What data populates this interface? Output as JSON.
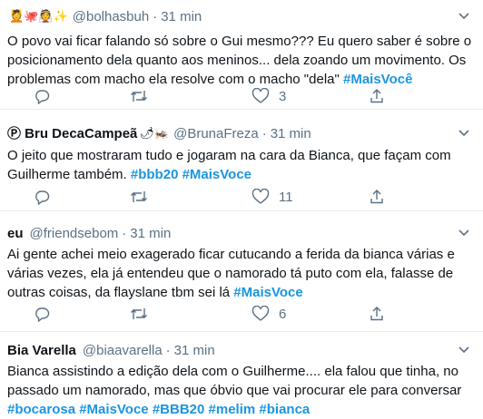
{
  "tweets": [
    {
      "name": "",
      "emojis": "💆🐙👰✨",
      "handle": "@bolhasbuh",
      "sep": "·",
      "time": "31 min",
      "text": "O povo vai ficar falando só sobre o Gui mesmo??? Eu quero saber é sobre o posicionamento dela quanto aos meninos... dela zoando um movimento. Os problemas com macho ela resolve com o macho \"dela\" ",
      "hashtags": [
        "#MaisVocê"
      ],
      "likes": "3"
    },
    {
      "name": "Ⓟ Bru DecaCampeã",
      "emojis": "🌶🦗",
      "handle": "@BrunaFreza",
      "sep": "·",
      "time": "31 min",
      "text": "O jeito que mostraram tudo e jogaram na cara da Bianca, que façam com Guilherme também. ",
      "hashtags": [
        "#bbb20",
        "#MaisVoce"
      ],
      "likes": "11"
    },
    {
      "name": "eu",
      "emojis": "",
      "handle": "@friendsebom",
      "sep": "·",
      "time": "31 min",
      "text": "Ai gente achei meio exagerado ficar cutucando a ferida da bianca várias e várias vezes, ela já entendeu que o namorado tá puto com ela, falasse de outras coisas, da flayslane tbm sei lá ",
      "hashtags": [
        "#MaisVoce"
      ],
      "likes": "6"
    },
    {
      "name": "Bia Varella",
      "emojis": "",
      "handle": "@biaavarella",
      "sep": "·",
      "time": "31 min",
      "text": "Bianca assistindo a edição dela com o Guilherme.... ela falou que tinha, no passado um namorado, mas que óbvio que vai procurar ele para conversar ",
      "hashtags": [
        "#bocarosa",
        "#MaisVoce",
        "#BBB20",
        "#melim",
        "#bianca"
      ],
      "likes": ""
    }
  ],
  "icons": {
    "more": "chevron-down-icon",
    "reply": "reply-icon",
    "retweet": "retweet-icon",
    "like": "heart-icon",
    "share": "share-icon"
  },
  "colors": {
    "hashtag": "#1b95e0",
    "secondary_text": "#5b7083",
    "divider": "#e6ecf0"
  }
}
